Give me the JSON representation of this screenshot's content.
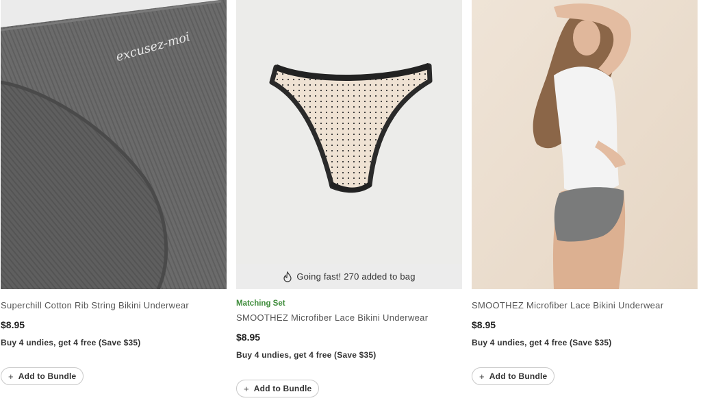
{
  "products": [
    {
      "image_text": "excusez-moi",
      "tag": "",
      "name": "Superchill Cotton Rib String Bikini Underwear",
      "price": "$8.95",
      "promo": "Buy 4 undies, get 4 free (Save $35)",
      "button": {
        "icon": "plus-icon",
        "label": "Add to Bundle"
      }
    },
    {
      "badge": {
        "icon": "flame-icon",
        "text": "Going fast! 270 added to bag"
      },
      "tag": "Matching Set",
      "name": "SMOOTHEZ Microfiber Lace Bikini Underwear",
      "price": "$8.95",
      "promo": "Buy 4 undies, get 4 free (Save $35)",
      "button": {
        "icon": "plus-icon",
        "label": "Add to Bundle"
      }
    },
    {
      "tag": "",
      "name": "SMOOTHEZ Microfiber Lace Bikini Underwear",
      "price": "$8.95",
      "promo": "Buy 4 undies, get 4 free (Save $35)",
      "button": {
        "icon": "plus-icon",
        "label": "Add to Bundle"
      }
    }
  ],
  "colors": {
    "tag_green": "#3e8c3a",
    "badge_bg": "#ececec",
    "grey_fabric": "#6f6f6f"
  }
}
